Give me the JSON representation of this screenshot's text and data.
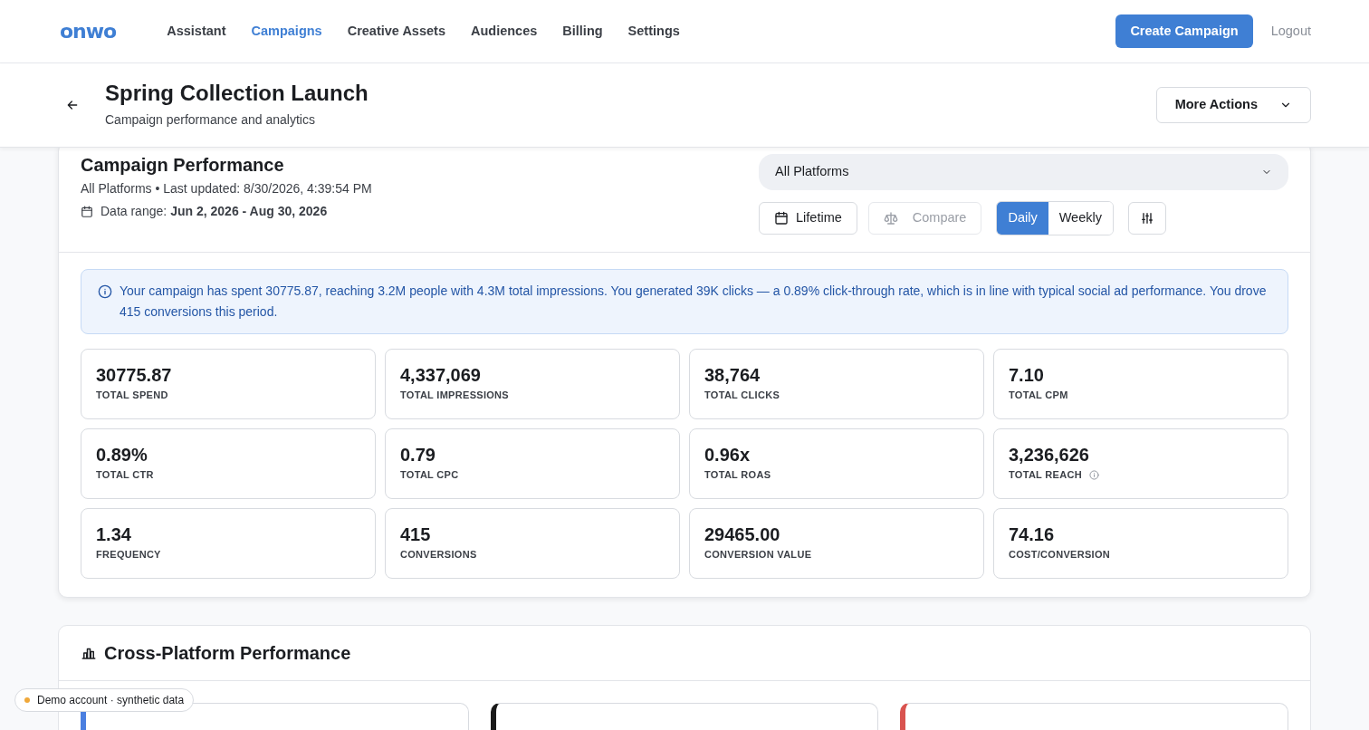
{
  "nav": {
    "logo": "onwo",
    "links": [
      {
        "label": "Assistant",
        "selected": false
      },
      {
        "label": "Campaigns",
        "selected": true
      },
      {
        "label": "Creative Assets",
        "selected": false
      },
      {
        "label": "Audiences",
        "selected": false
      },
      {
        "label": "Billing",
        "selected": false
      },
      {
        "label": "Settings",
        "selected": false
      }
    ],
    "create_button": "Create Campaign",
    "logout": "Logout"
  },
  "page_header": {
    "title": "Spring Collection Launch",
    "subtitle": "Campaign performance and analytics",
    "more_actions": "More Actions"
  },
  "performance": {
    "title": "Campaign Performance",
    "meta": "All Platforms • Last updated: 8/30/2026, 4:39:54 PM",
    "date_label": "Data range:",
    "date_value": "Jun 2, 2026 - Aug 30, 2026",
    "platform_select": "All Platforms",
    "lifetime": {
      "label": "Lifetime",
      "disabled": false
    },
    "compare": {
      "label": "Compare",
      "disabled": true
    },
    "granularity": [
      {
        "label": "Daily",
        "selected": true
      },
      {
        "label": "Weekly",
        "selected": false
      }
    ],
    "summary": "Your campaign has spent 30775.87, reaching 3.2M people with 4.3M total impressions. You generated 39K clicks — a 0.89% click-through rate, which is in line with typical social ad performance. You drove 415 conversions this period.",
    "metrics": [
      {
        "value": "30775.87",
        "label": "TOTAL SPEND",
        "info": false
      },
      {
        "value": "4,337,069",
        "label": "TOTAL IMPRESSIONS",
        "info": false
      },
      {
        "value": "38,764",
        "label": "TOTAL CLICKS",
        "info": false
      },
      {
        "value": "7.10",
        "label": "TOTAL CPM",
        "info": false
      },
      {
        "value": "0.89%",
        "label": "TOTAL CTR",
        "info": false
      },
      {
        "value": "0.79",
        "label": "TOTAL CPC",
        "info": false
      },
      {
        "value": "0.96x",
        "label": "TOTAL ROAS",
        "info": false
      },
      {
        "value": "3,236,626",
        "label": "TOTAL REACH",
        "info": true
      },
      {
        "value": "1.34",
        "label": "FREQUENCY",
        "info": false
      },
      {
        "value": "415",
        "label": "CONVERSIONS",
        "info": false
      },
      {
        "value": "29465.00",
        "label": "CONVERSION VALUE",
        "info": false
      },
      {
        "value": "74.16",
        "label": "COST/CONVERSION",
        "info": false
      }
    ]
  },
  "cross_platform": {
    "title": "Cross-Platform Performance",
    "platforms": [
      {
        "color": "#4a7fe0"
      },
      {
        "color": "#1a1a1a"
      },
      {
        "color": "#d9534f"
      }
    ]
  },
  "demo_badge": "Demo account · synthetic data"
}
